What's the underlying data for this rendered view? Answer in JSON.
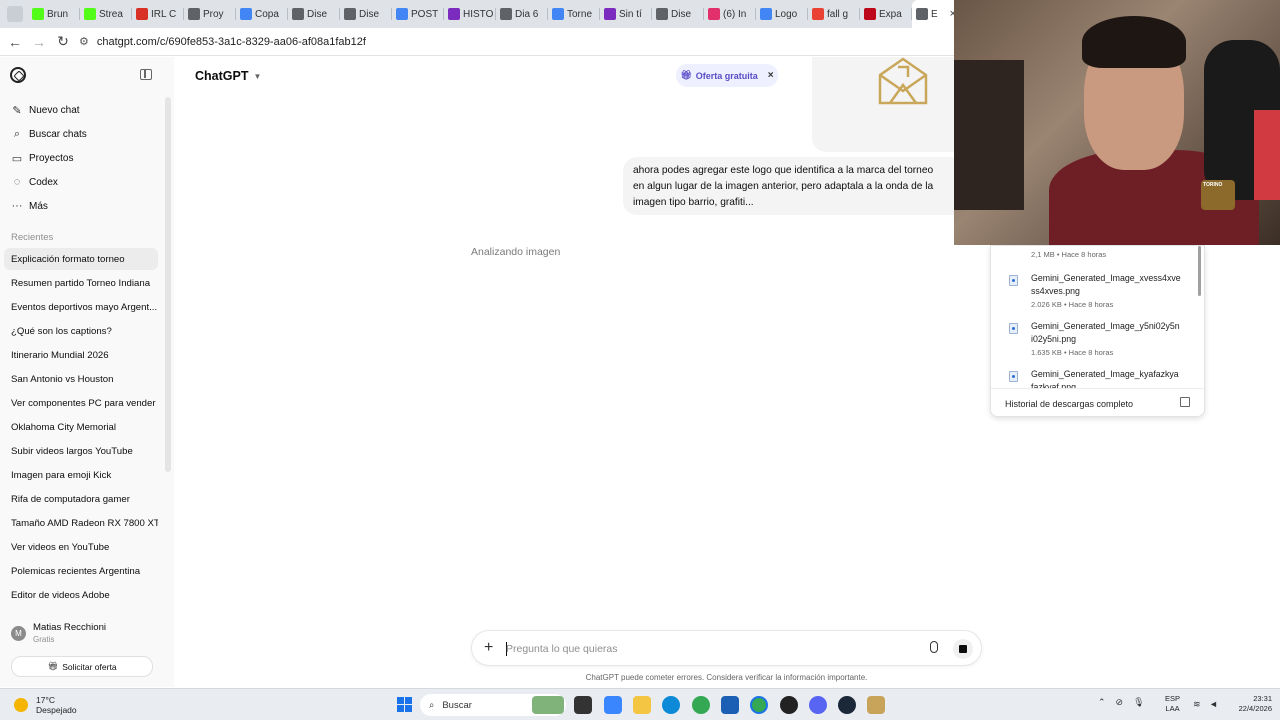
{
  "browser": {
    "tabs": [
      {
        "label": "Brun",
        "icon": "kick-icon",
        "color": "#53fc18"
      },
      {
        "label": "Strea",
        "icon": "kick-icon",
        "color": "#53fc18"
      },
      {
        "label": "IRL C",
        "icon": "irl-icon",
        "color": "#d93025"
      },
      {
        "label": "Proy",
        "icon": "chatgpt-icon",
        "color": "#5f6368"
      },
      {
        "label": "Copa",
        "icon": "copilot-icon",
        "color": "#4285f4"
      },
      {
        "label": "Dise",
        "icon": "chatgpt-icon",
        "color": "#5f6368"
      },
      {
        "label": "Dise",
        "icon": "chatgpt-icon",
        "color": "#5f6368"
      },
      {
        "label": "POST",
        "icon": "copilot-icon",
        "color": "#4285f4"
      },
      {
        "label": "HISTO",
        "icon": "video-icon",
        "color": "#7b2cbf"
      },
      {
        "label": "Dia 6",
        "icon": "chatgpt-icon",
        "color": "#5f6368"
      },
      {
        "label": "Torne",
        "icon": "docs-icon",
        "color": "#4285f4"
      },
      {
        "label": "Sin tí",
        "icon": "video-icon",
        "color": "#7b2cbf"
      },
      {
        "label": "Dise",
        "icon": "chatgpt-icon",
        "color": "#5f6368"
      },
      {
        "label": "(6) In",
        "icon": "instagram-icon",
        "color": "#e1306c"
      },
      {
        "label": "Logo",
        "icon": "gemini-icon",
        "color": "#4285f4"
      },
      {
        "label": "fall g",
        "icon": "google-icon",
        "color": "#ea4335"
      },
      {
        "label": "Expa",
        "icon": "pinterest-icon",
        "color": "#bd081c"
      },
      {
        "label": "E",
        "icon": "chatgpt-icon",
        "color": "#5f6368",
        "active": true
      },
      {
        "label": "",
        "icon": "youtube-icon",
        "color": "#ff0000"
      }
    ],
    "active_tab_close": "×",
    "url": "chatgpt.com/c/690fe853-3a1c-8329-aa06-af08a1fab12f"
  },
  "sidebar": {
    "nav": [
      {
        "label": "Nuevo chat",
        "icon": "new-chat-icon",
        "glyph": "✎"
      },
      {
        "label": "Buscar chats",
        "icon": "search-icon",
        "glyph": "⌕"
      },
      {
        "label": "Proyectos",
        "icon": "folder-icon",
        "glyph": "▭"
      },
      {
        "label": "Codex",
        "icon": "codex-icon",
        "glyph": "◌"
      },
      {
        "label": "Más",
        "icon": "more-icon",
        "glyph": "···"
      }
    ],
    "recents_label": "Recientes",
    "recents": [
      "Explicación formato torneo",
      "Resumen partido Torneo Indiana",
      "Eventos deportivos mayo Argent...",
      "¿Qué son los captions?",
      "Itinerario Mundial 2026",
      "San Antonio vs Houston",
      "Ver componentes PC para vender",
      "Oklahoma City Memorial",
      "Subir videos largos YouTube",
      "Imagen para emoji Kick",
      "Rifa de computadora gamer",
      "Tamaño AMD Radeon RX 7800 XT",
      "Ver videos en YouTube",
      "Polemicas recientes Argentina",
      "Editor de videos Adobe"
    ],
    "user": {
      "initial": "M",
      "name": "Matias Recchioni",
      "plan": "Gratis"
    },
    "offer_button": "Solicitar oferta"
  },
  "main": {
    "model": "ChatGPT",
    "promo": "Oferta gratuita",
    "promo_close": "×",
    "user_message": "ahora podes agregar este logo que identifica a la marca del torneo en algun lugar de la imagen anterior, pero adaptala a la onda de la imagen tipo barrio, grafiti...",
    "status": "Analizando imagen",
    "composer_placeholder": "Pregunta lo que quieras",
    "disclaimer": "ChatGPT puede cometer errores. Considera verificar la información importante."
  },
  "downloads": {
    "partial_meta": "2,1 MB • Hace 8 horas",
    "items": [
      {
        "name": "Gemini_Generated_Image_xvess4xvess4xves.png",
        "meta": "2.026 KB • Hace 8 horas"
      },
      {
        "name": "Gemini_Generated_Image_y5ni02y5ni02y5ni.png",
        "meta": "1.635 KB • Hace 8 horas"
      },
      {
        "name": "Gemini_Generated_Image_kyafazkyafazkyaf.png",
        "meta": ""
      }
    ],
    "footer": "Historial de descargas completo"
  },
  "webcam": {
    "crest_text": "TORINO"
  },
  "taskbar": {
    "temperature": "17°C",
    "weather": "Despejado",
    "search": "Buscar",
    "lang_top": "ESP",
    "lang_bottom": "LAA",
    "time": "23:31",
    "date": "22/4/2026"
  },
  "colors": {
    "accent": "#5a4cc7",
    "promo_bg": "#eef0ff",
    "sidebar_bg": "#f9f9f9"
  }
}
